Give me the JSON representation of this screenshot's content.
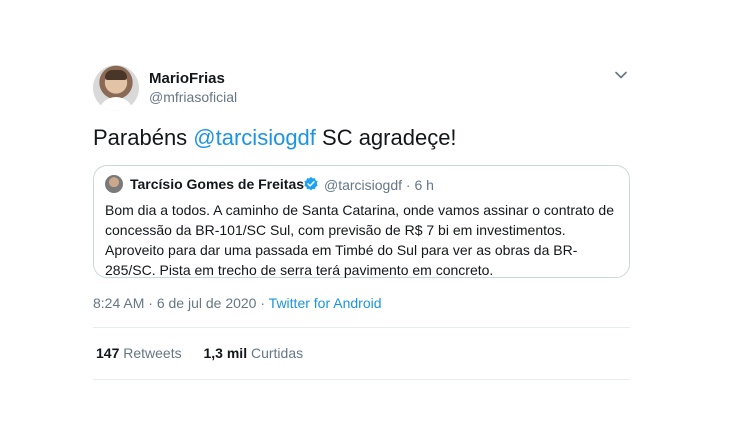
{
  "author": {
    "name": "MarioFrias",
    "handle": "@mfriasoficial"
  },
  "tweet": {
    "text_before": "Parabéns ",
    "mention": "@tarcisiogdf",
    "text_after": " SC agradeçe!"
  },
  "quoted": {
    "name": "Tarcísio Gomes de Freitas",
    "handle": "@tarcisiogdf",
    "separator": "·",
    "time": "6 h",
    "lines": [
      "Bom dia a todos. A caminho de Santa Catarina, onde vamos assinar o contrato de",
      "concessão da BR-101/SC Sul, com previsão de R$ 7 bi em investimentos.",
      "Aproveito para dar uma passada em Timbé do Sul para ver as obras da BR-",
      "285/SC. Pista em trecho de serra terá pavimento em concreto."
    ]
  },
  "meta": {
    "time": "8:24 AM",
    "dot1": "·",
    "date": "6 de jul de 2020",
    "dot2": "·",
    "source": "Twitter for Android"
  },
  "stats": {
    "retweets_count": "147",
    "retweets_label": "Retweets",
    "likes_count": "1,3 mil",
    "likes_label": "Curtidas"
  },
  "colors": {
    "link": "#1b95e0",
    "secondary": "#657786",
    "verified": "#1da1f2"
  },
  "icons": {
    "menu": "chevron-down-icon",
    "verified": "verified-badge-icon"
  }
}
